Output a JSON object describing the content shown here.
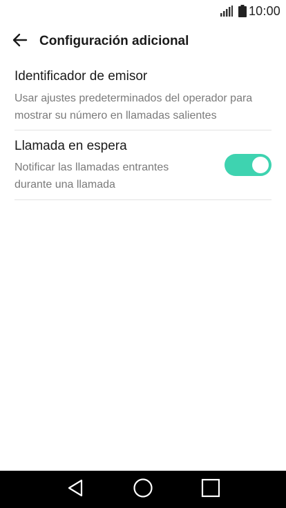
{
  "status_bar": {
    "time": "10:00",
    "icons": [
      "signal-icon",
      "battery-icon"
    ]
  },
  "header": {
    "back_icon": "arrow-left-icon",
    "title": "Configuración adicional"
  },
  "settings": [
    {
      "title": "Identificador de emisor",
      "summary": "Usar ajustes predeterminados del operador para mostrar su número en llamadas salientes"
    },
    {
      "title": "Llamada en espera",
      "summary": "Notificar las llamadas entrantes durante una llamada",
      "toggle_on": true
    }
  ],
  "colors": {
    "accent": "#3ed3b0",
    "nav_background": "#000000"
  },
  "nav_bar": {
    "icons": [
      "back-triangle-icon",
      "home-circle-icon",
      "recents-square-icon"
    ]
  }
}
